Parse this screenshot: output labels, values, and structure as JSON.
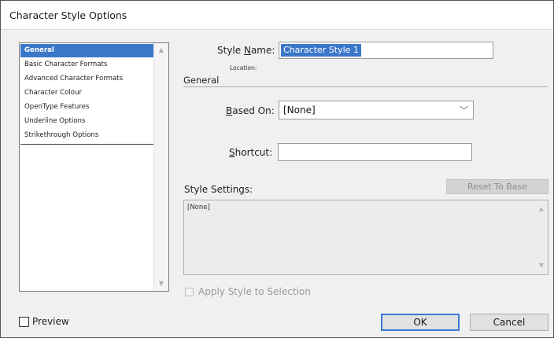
{
  "window": {
    "title": "Character Style Options"
  },
  "sidebar": {
    "items": [
      {
        "label": "General",
        "selected": true
      },
      {
        "label": "Basic Character Formats",
        "selected": false
      },
      {
        "label": "Advanced Character Formats",
        "selected": false
      },
      {
        "label": "Character Colour",
        "selected": false
      },
      {
        "label": "OpenType Features",
        "selected": false
      },
      {
        "label": "Underline Options",
        "selected": false
      },
      {
        "label": "Strikethrough Options",
        "selected": false
      }
    ]
  },
  "form": {
    "style_name_label_pre": "Style ",
    "style_name_label_key": "N",
    "style_name_label_post": "ame:",
    "style_name_value": "Character Style 1",
    "location_label": "Location:",
    "section_title": "General",
    "based_on_label_key": "B",
    "based_on_label_post": "ased On:",
    "based_on_value": "[None]",
    "shortcut_label_key": "S",
    "shortcut_label_post": "hortcut:",
    "shortcut_value": "",
    "style_settings_label": "Style Settings:",
    "reset_button": "Reset To Base",
    "style_settings_text": "[None]",
    "apply_label": "Apply Style to Selection",
    "apply_checked": false
  },
  "footer": {
    "preview_label": "Preview",
    "preview_checked": false,
    "ok_label": "OK",
    "cancel_label": "Cancel"
  },
  "colors": {
    "selection": "#3a77c9",
    "default_button_border": "#3b78d8"
  }
}
